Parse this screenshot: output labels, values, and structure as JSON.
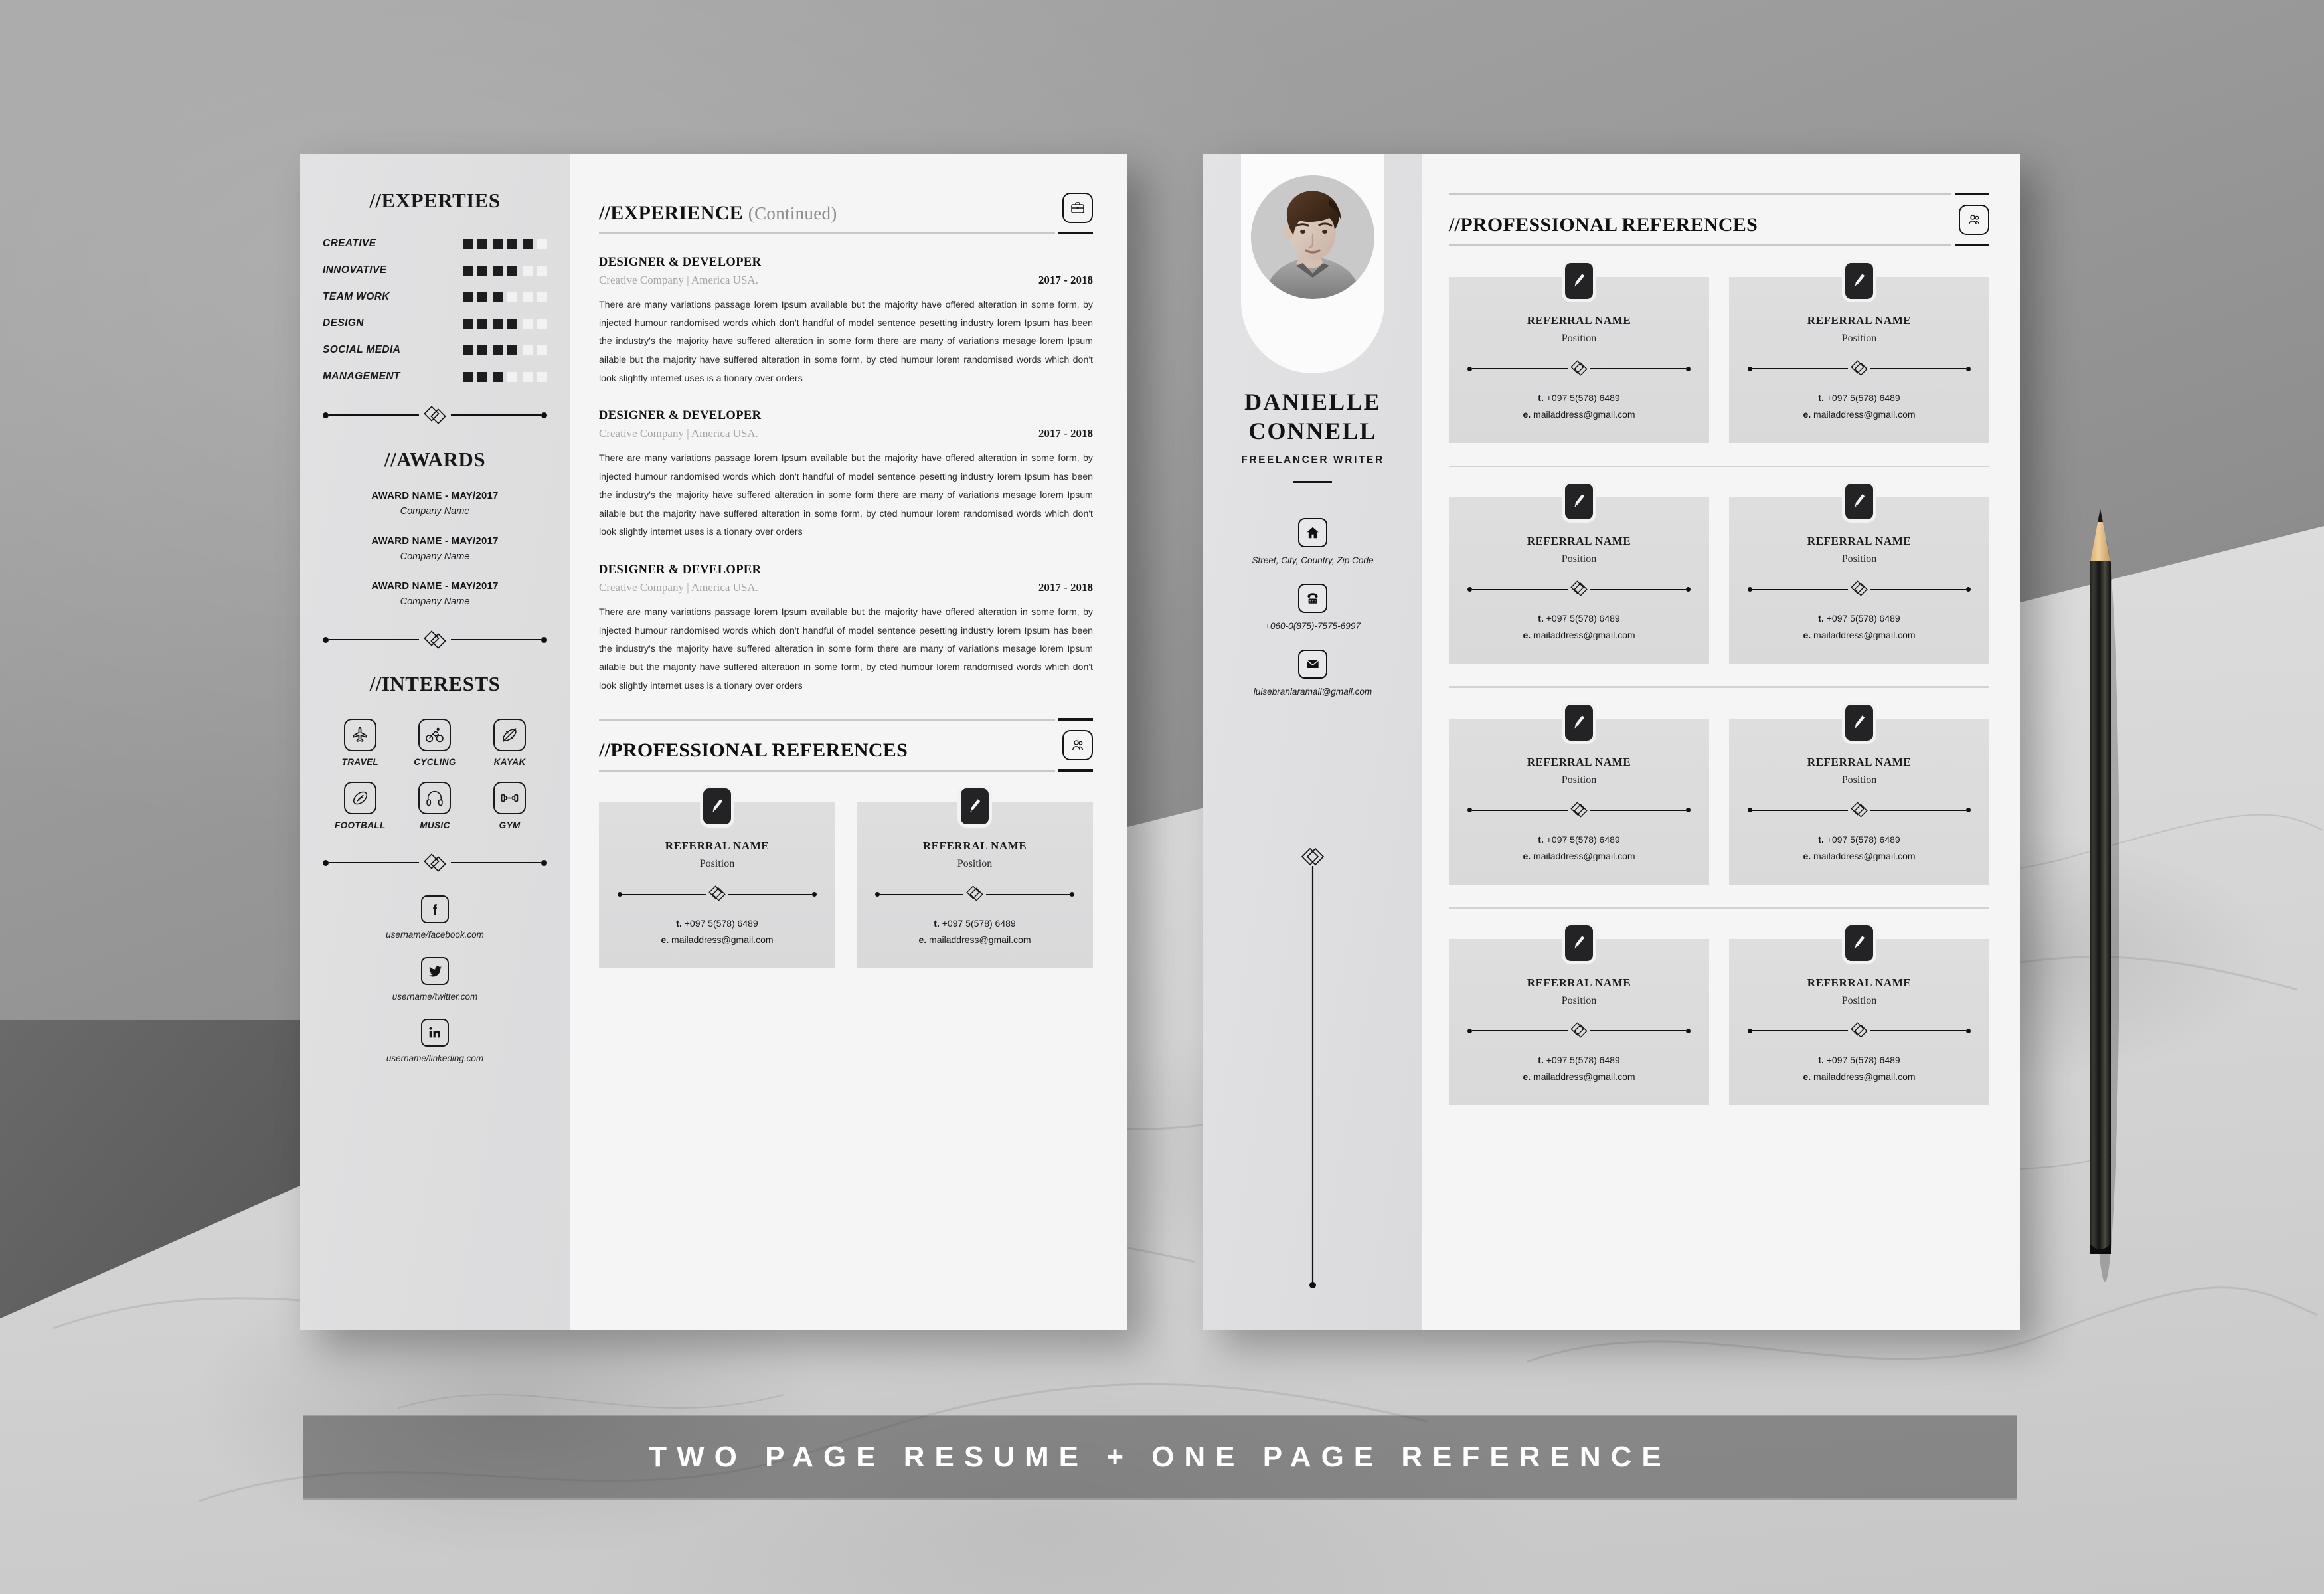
{
  "banner": {
    "text": "TWO PAGE RESUME + ONE PAGE REFERENCE"
  },
  "page1": {
    "sidebar": {
      "experties": {
        "title": "//EXPERTIES",
        "max_dots": 6,
        "skills": [
          {
            "label": "CREATIVE",
            "level": 5
          },
          {
            "label": "INNOVATIVE",
            "level": 4
          },
          {
            "label": "TEAM WORK",
            "level": 3
          },
          {
            "label": "DESIGN",
            "level": 4
          },
          {
            "label": "SOCIAL MEDIA",
            "level": 4
          },
          {
            "label": "MANAGEMENT",
            "level": 3
          }
        ]
      },
      "awards": {
        "title": "//AWARDS",
        "items": [
          {
            "name": "AWARD NAME - MAY/2017",
            "company": "Company Name"
          },
          {
            "name": "AWARD NAME - MAY/2017",
            "company": "Company Name"
          },
          {
            "name": "AWARD NAME - MAY/2017",
            "company": "Company Name"
          }
        ]
      },
      "interests": {
        "title": "//INTERESTS",
        "items": [
          {
            "label": "TRAVEL",
            "icon": "airplane-icon"
          },
          {
            "label": "CYCLING",
            "icon": "cyclist-icon"
          },
          {
            "label": "KAYAK",
            "icon": "kayak-icon"
          },
          {
            "label": "FOOTBALL",
            "icon": "football-icon"
          },
          {
            "label": "MUSIC",
            "icon": "headphones-icon"
          },
          {
            "label": "GYM",
            "icon": "dumbbell-icon"
          }
        ]
      },
      "socials": [
        {
          "icon": "facebook-icon",
          "url": "username/facebook.com"
        },
        {
          "icon": "twitter-icon",
          "url": "username/twitter.com"
        },
        {
          "icon": "linkedin-icon",
          "url": "username/linkeding.com"
        }
      ]
    },
    "experience": {
      "title": "//EXPERIENCE",
      "continued": "(Continued)",
      "icon": "briefcase-icon",
      "jobs": [
        {
          "title": "DESIGNER & DEVELOPER",
          "company": "Creative Company | America USA.",
          "years": "2017 - 2018",
          "body": "There are many variations passage lorem Ipsum available but the majority have offered alteration in some form, by injected humour randomised words which don't handful of model sentence pesetting industry lorem Ipsum has been the industry's the majority have suffered alteration in some form there are many of variations mesage lorem Ipsum ailable but the majority have suffered alteration in some form, by cted humour lorem randomised words which don't look slightly internet uses is a tionary over orders"
        },
        {
          "title": "DESIGNER & DEVELOPER",
          "company": "Creative Company | America USA.",
          "years": "2017 - 2018",
          "body": "There are many variations passage lorem Ipsum available but the majority have offered alteration in some form, by injected humour randomised words which don't handful of model sentence pesetting industry lorem Ipsum has been the industry's the majority have suffered alteration in some form there are many of variations mesage lorem Ipsum ailable but the majority have suffered alteration in some form, by cted humour lorem randomised words which don't look slightly internet uses is a tionary over orders"
        },
        {
          "title": "DESIGNER & DEVELOPER",
          "company": "Creative Company | America USA.",
          "years": "2017 - 2018",
          "body": "There are many variations passage lorem Ipsum available but the majority have offered alteration in some form, by injected humour randomised words which don't handful of model sentence pesetting industry lorem Ipsum has been the industry's the majority have suffered alteration in some form there are many of variations mesage lorem Ipsum ailable but the majority have suffered alteration in some form, by cted humour lorem randomised words which don't look slightly internet uses is a tionary over orders"
        }
      ]
    },
    "references": {
      "title": "//PROFESSIONAL REFERENCES",
      "icon": "people-icon",
      "cards": [
        {
          "name": "REFERRAL NAME",
          "position": "Position",
          "tel_prefix": "t.",
          "tel": "+097 5(578) 6489",
          "mail_prefix": "e.",
          "mail": "mailaddress@gmail.com",
          "icon": "pen-icon"
        },
        {
          "name": "REFERRAL NAME",
          "position": "Position",
          "tel_prefix": "t.",
          "tel": "+097 5(578) 6489",
          "mail_prefix": "e.",
          "mail": "mailaddress@gmail.com",
          "icon": "pen-icon"
        }
      ]
    }
  },
  "page2": {
    "profile": {
      "name_line1": "DANIELLE",
      "name_line2": "CONNELL",
      "role": "FREELANCER WRITER",
      "avatar": "profile-photo"
    },
    "contact": [
      {
        "icon": "home-icon",
        "text": "Street, City, Country, Zip Code"
      },
      {
        "icon": "phone-icon",
        "text": "+060-0(875)-7575-6997"
      },
      {
        "icon": "mail-icon",
        "text": "luisebranlaramail@gmail.com"
      }
    ],
    "references": {
      "title": "//PROFESSIONAL REFERENCES",
      "icon": "people-icon",
      "rows": [
        [
          {
            "name": "REFERRAL NAME",
            "position": "Position",
            "tel_prefix": "t.",
            "tel": "+097 5(578) 6489",
            "mail_prefix": "e.",
            "mail": "mailaddress@gmail.com",
            "icon": "pen-icon"
          },
          {
            "name": "REFERRAL NAME",
            "position": "Position",
            "tel_prefix": "t.",
            "tel": "+097 5(578) 6489",
            "mail_prefix": "e.",
            "mail": "mailaddress@gmail.com",
            "icon": "pen-icon"
          }
        ],
        [
          {
            "name": "REFERRAL NAME",
            "position": "Position",
            "tel_prefix": "t.",
            "tel": "+097 5(578) 6489",
            "mail_prefix": "e.",
            "mail": "mailaddress@gmail.com",
            "icon": "pen-icon"
          },
          {
            "name": "REFERRAL NAME",
            "position": "Position",
            "tel_prefix": "t.",
            "tel": "+097 5(578) 6489",
            "mail_prefix": "e.",
            "mail": "mailaddress@gmail.com",
            "icon": "pen-icon"
          }
        ],
        [
          {
            "name": "REFERRAL NAME",
            "position": "Position",
            "tel_prefix": "t.",
            "tel": "+097 5(578) 6489",
            "mail_prefix": "e.",
            "mail": "mailaddress@gmail.com",
            "icon": "pen-icon"
          },
          {
            "name": "REFERRAL NAME",
            "position": "Position",
            "tel_prefix": "t.",
            "tel": "+097 5(578) 6489",
            "mail_prefix": "e.",
            "mail": "mailaddress@gmail.com",
            "icon": "pen-icon"
          }
        ],
        [
          {
            "name": "REFERRAL NAME",
            "position": "Position",
            "tel_prefix": "t.",
            "tel": "+097 5(578) 6489",
            "mail_prefix": "e.",
            "mail": "mailaddress@gmail.com",
            "icon": "pen-icon"
          },
          {
            "name": "REFERRAL NAME",
            "position": "Position",
            "tel_prefix": "t.",
            "tel": "+097 5(578) 6489",
            "mail_prefix": "e.",
            "mail": "mailaddress@gmail.com",
            "icon": "pen-icon"
          }
        ]
      ]
    }
  },
  "decor": {
    "pencil": "black-pencil"
  },
  "colors": {
    "ink": "#18181a",
    "paper": "#f5f5f6",
    "panel": "#dedee0",
    "card": "#dcdcdd",
    "muted": "#a4a4a7"
  }
}
